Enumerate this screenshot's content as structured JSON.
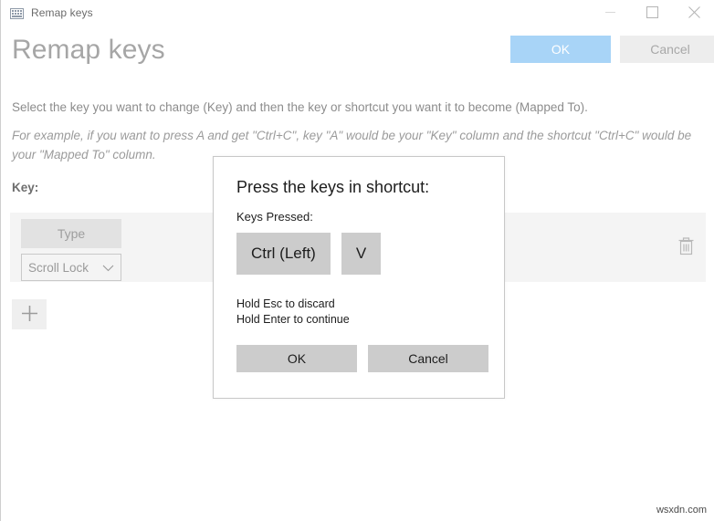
{
  "window": {
    "title": "Remap keys",
    "icon": "keyboard-icon",
    "controls": {
      "minimize": "minimize-icon",
      "maximize": "maximize-icon",
      "close": "close-icon"
    }
  },
  "header": {
    "page_title": "Remap keys",
    "ok_label": "OK",
    "cancel_label": "Cancel",
    "ok_color": "#a8d4f7",
    "cancel_color": "#ededed"
  },
  "body": {
    "description": "Select the key you want to change (Key) and then the key or shortcut you want it to become (Mapped To).",
    "example": "For example, if you want to press A and get \"Ctrl+C\", key \"A\" would be your \"Key\" column and the shortcut \"Ctrl+C\" would be your \"Mapped To\" column.",
    "key_column_label": "Key:"
  },
  "mapping_row": {
    "type_button_label": "Type",
    "key_select_value": "Scroll Lock",
    "key_select_chevron": "chevron-down-icon",
    "delete_icon": "trash-icon"
  },
  "add_row": {
    "icon": "plus-icon"
  },
  "dialog": {
    "title": "Press the keys in shortcut:",
    "subtitle": "Keys Pressed:",
    "keys": [
      "Ctrl (Left)",
      "V"
    ],
    "hint_line_1": "Hold Esc to discard",
    "hint_line_2": "Hold Enter to continue",
    "ok_label": "OK",
    "cancel_label": "Cancel"
  },
  "watermark": {
    "text": "wsxdn.com"
  }
}
